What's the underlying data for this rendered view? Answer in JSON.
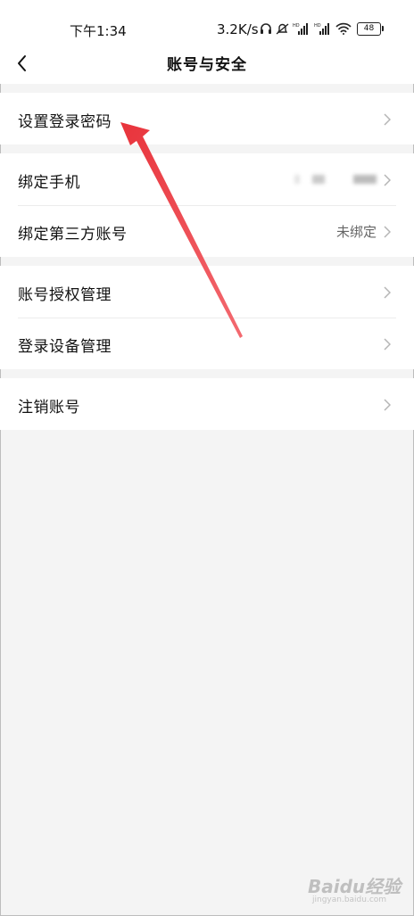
{
  "status_bar": {
    "time": "下午1:34",
    "network_speed": "3.2K/s",
    "battery": "48",
    "icons": [
      "headphones-icon",
      "mute-icon",
      "signal-hd-icon",
      "signal-hd-icon",
      "wifi-icon",
      "battery-icon"
    ]
  },
  "header": {
    "title": "账号与安全",
    "back_icon": "back-arrow-icon"
  },
  "groups": [
    {
      "items": [
        {
          "label": "设置登录密码",
          "value": ""
        }
      ]
    },
    {
      "items": [
        {
          "label": "绑定手机",
          "value": ""
        },
        {
          "label": "绑定第三方账号",
          "value": "未绑定"
        }
      ]
    },
    {
      "items": [
        {
          "label": "账号授权管理",
          "value": ""
        },
        {
          "label": "登录设备管理",
          "value": ""
        }
      ]
    },
    {
      "items": [
        {
          "label": "注销账号",
          "value": ""
        }
      ]
    }
  ],
  "annotation": {
    "color": "#f0414a",
    "points_to": "设置登录密码"
  },
  "watermark": {
    "text": "Baidu经验",
    "sub": "jingyan.baidu.com"
  }
}
